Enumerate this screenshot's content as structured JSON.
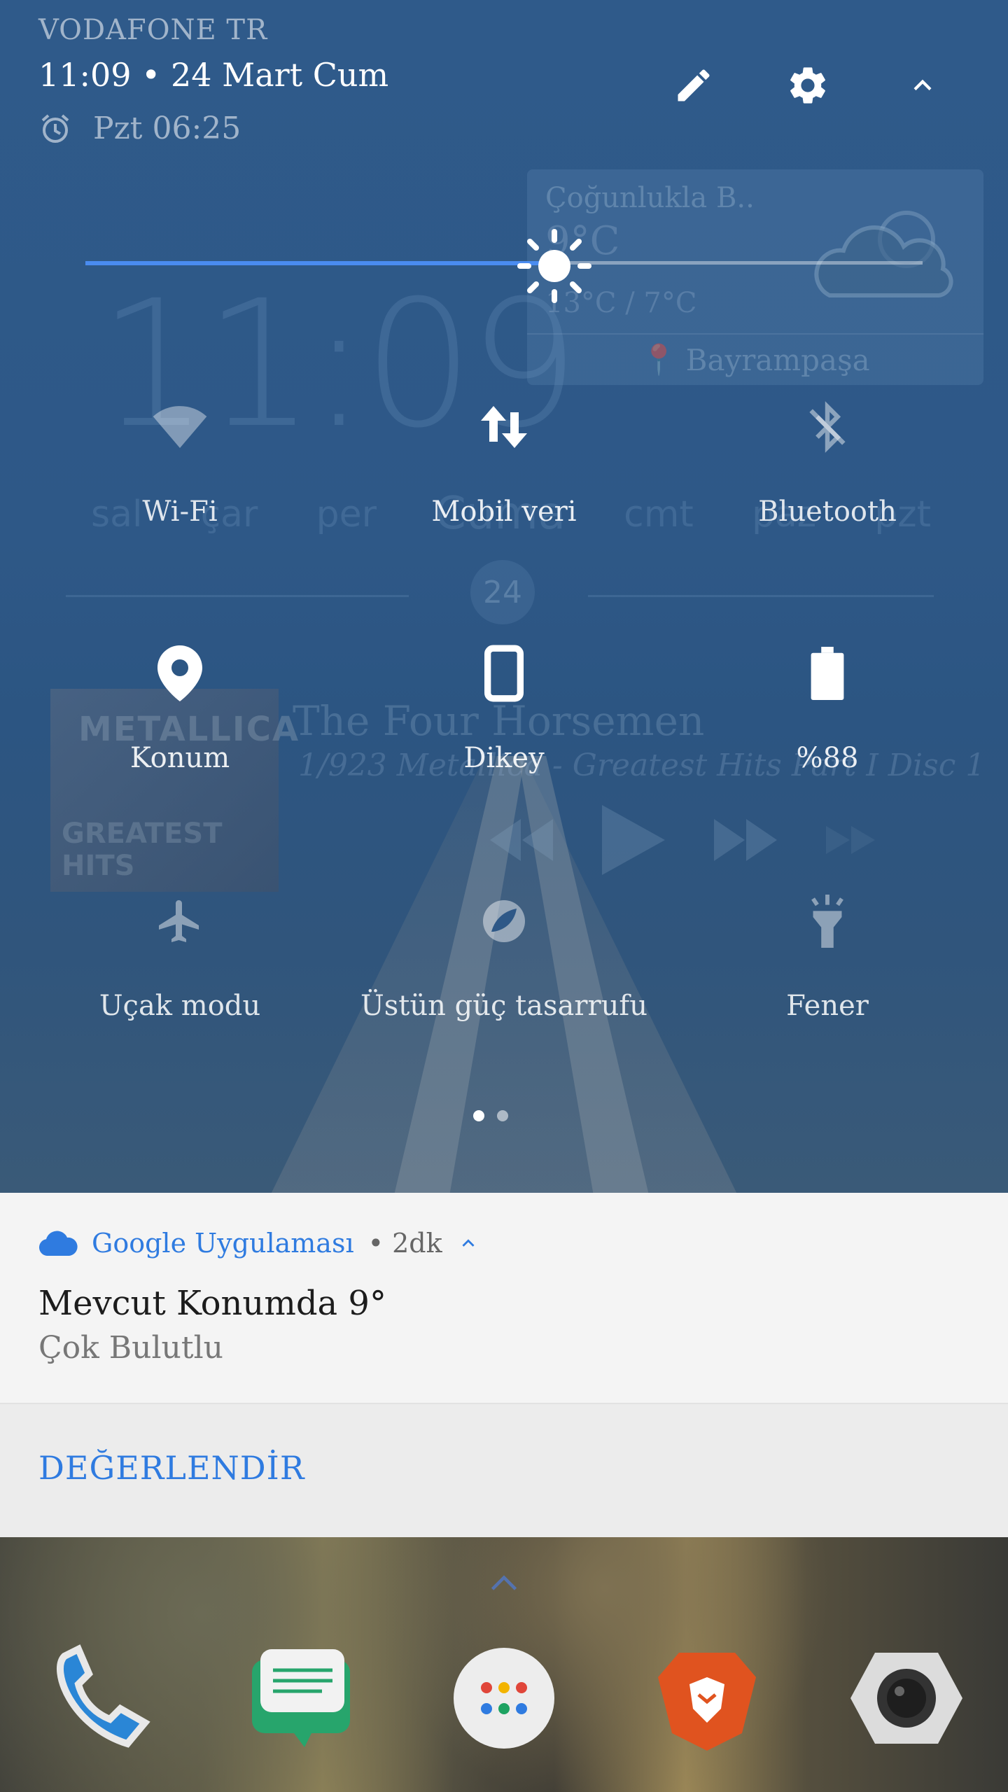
{
  "status": {
    "carrier": "VODAFONE TR",
    "datetime": "11:09 • 24 Mart Cum",
    "alarm": "Pzt 06:25"
  },
  "header_icons": [
    "edit-icon",
    "settings-icon",
    "chevron-up-icon"
  ],
  "brightness": {
    "level": 0.56,
    "accent": "#4a8cf0"
  },
  "quick_tiles": [
    {
      "label": "Wi-Fi",
      "icon": "wifi-icon",
      "active": false
    },
    {
      "label": "Mobil veri",
      "icon": "mobile-data-icon",
      "active": true
    },
    {
      "label": "Bluetooth",
      "icon": "bluetooth-off-icon",
      "active": false
    },
    {
      "label": "Konum",
      "icon": "location-icon",
      "active": true
    },
    {
      "label": "Dikey",
      "icon": "portrait-icon",
      "active": true
    },
    {
      "label": "%88",
      "icon": "battery-icon",
      "active": true
    },
    {
      "label": "Uçak modu",
      "icon": "airplane-icon",
      "active": false
    },
    {
      "label": "Üstün güç tasarrufu",
      "icon": "power-saver-icon",
      "active": false
    },
    {
      "label": "Fener",
      "icon": "flashlight-icon",
      "active": false
    }
  ],
  "pager": {
    "pages": 2,
    "current": 1
  },
  "background_widgets": {
    "clock": "11:09",
    "days": [
      "sal",
      "çar",
      "per",
      "Cuma",
      "cmt",
      "paz",
      "pzt"
    ],
    "day_number": "24",
    "weather": {
      "condition": "Çoğunlukla B..",
      "temp": "9°C",
      "range": "13°C / 7°C",
      "location": "Bayrampaşa"
    },
    "music": {
      "title": "The Four Horsemen",
      "subtitle": "1/923 Metallica - Greatest Hits Part I Disc 1",
      "album_art_text": "METALLICA",
      "album_art_sub": "GREATEST HITS"
    }
  },
  "notification": {
    "app": "Google Uygulaması",
    "time": "• 2dk",
    "title": "Mevcut Konumda 9°",
    "body": "Çok Bulutlu",
    "action": "DEĞERLENDİR",
    "accent": "#2f7be0"
  },
  "dock": {
    "apps": [
      "phone-icon",
      "messages-icon",
      "app-drawer-icon",
      "brave-browser-icon",
      "camera-icon"
    ]
  }
}
